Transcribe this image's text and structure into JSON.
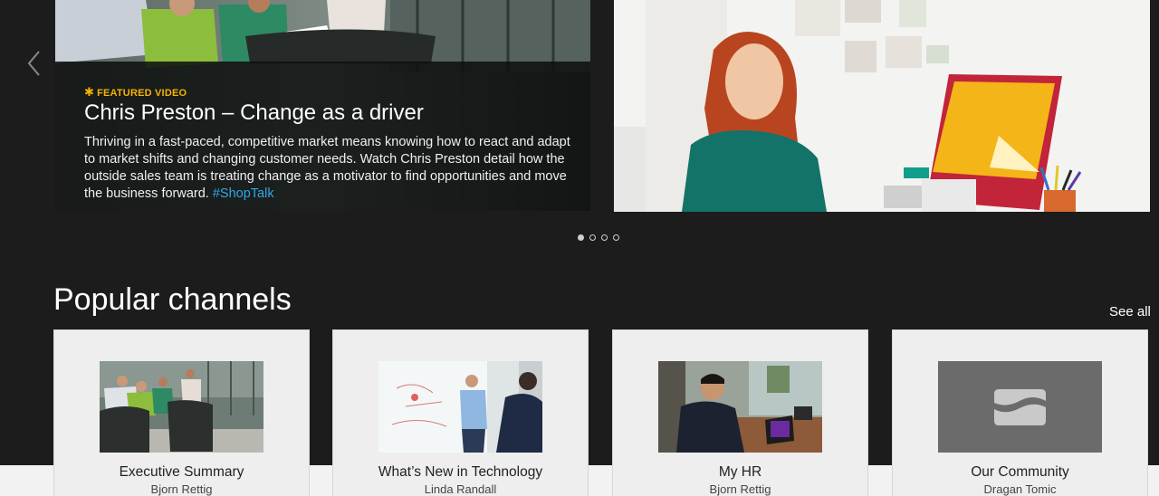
{
  "carousel": {
    "featured": {
      "tag": "FEATURED VIDEO",
      "title": "Chris Preston – Change as a driver",
      "description": "Thriving in a fast-paced, competitive market means knowing how to react and adapt to market shifts and changing customer needs. Watch Chris Preston detail how the outside sales team is treating change as a motivator to find opportunities and move the business forward.",
      "hashtag": "#ShopTalk"
    },
    "page_count": 4,
    "active_page": 1
  },
  "popular": {
    "title": "Popular channels",
    "see_all": "See all",
    "channels": [
      {
        "title": "Executive Summary",
        "owner": "Bjorn Rettig"
      },
      {
        "title": "What’s New in Technology",
        "owner": "Linda Randall"
      },
      {
        "title": "My HR",
        "owner": "Bjorn Rettig"
      },
      {
        "title": "Our Community",
        "owner": "Dragan Tomic"
      }
    ]
  },
  "colors": {
    "background": "#1c1c1c",
    "accent_tag": "#f5b300",
    "hashtag": "#2fa8e6",
    "card": "#eeeeee"
  }
}
